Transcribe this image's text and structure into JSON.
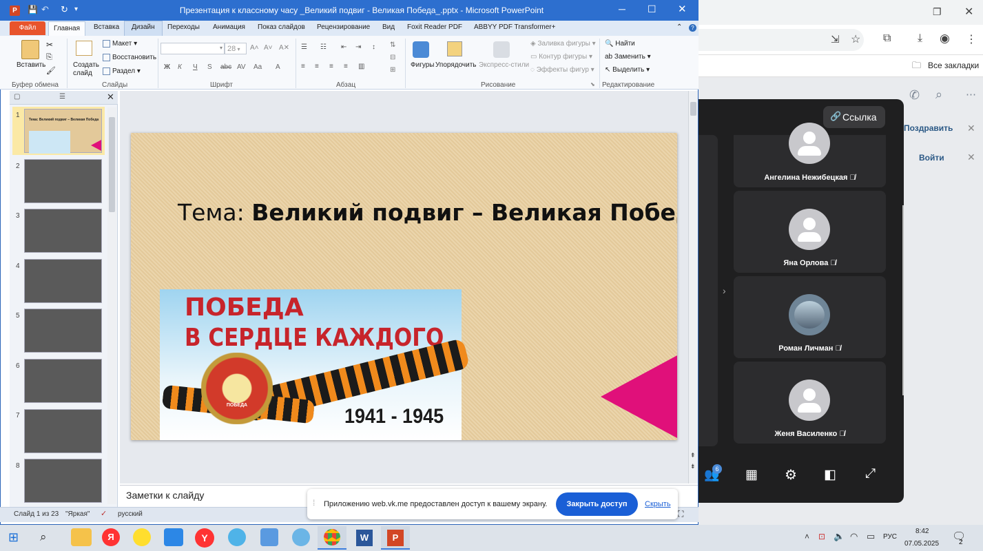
{
  "window": {
    "title": "Презентация к классному часу _Великий подвиг - Великая Победа_.pptx  -  Microsoft PowerPoint"
  },
  "ribbon": {
    "tabs": [
      "Файл",
      "Главная",
      "Вставка",
      "Дизайн",
      "Переходы",
      "Анимация",
      "Показ слайдов",
      "Рецензирование",
      "Вид",
      "Foxit Reader PDF",
      "ABBYY PDF Transformer+"
    ],
    "clipboard": {
      "paste": "Вставить",
      "label": "Буфер обмена"
    },
    "slides": {
      "create": "Создать слайд",
      "layout": "Макет",
      "restore": "Восстановить",
      "section": "Раздел",
      "label": "Слайды"
    },
    "font": {
      "size": "28",
      "label": "Шрифт"
    },
    "paragraph": {
      "label": "Абзац"
    },
    "drawing": {
      "shapes": "Фигуры",
      "arrange": "Упорядочить",
      "quick_styles": "Экспресс-стили",
      "fill": "Заливка фигуры",
      "outline": "Контур фигуры",
      "effects": "Эффекты фигур",
      "label": "Рисование"
    },
    "editing": {
      "find": "Найти",
      "replace": "Заменить",
      "select": "Выделить",
      "label": "Редактирование"
    }
  },
  "slide": {
    "title_prefix": "Тема: ",
    "title_bold": "Великий подвиг – Великая Победа",
    "poster_line1": "ПОБЕДА",
    "poster_line2": "В СЕРДЦЕ КАЖДОГО",
    "poster_years": "1941 - 1945",
    "poster_medal": "ПОБЕДА"
  },
  "thumbnails": {
    "numbers": [
      "1",
      "2",
      "3",
      "4",
      "5",
      "6",
      "7",
      "8"
    ],
    "thumb1_title": "Тема: Великий подвиг – Великая Победа"
  },
  "notes": {
    "placeholder": "Заметки к слайду"
  },
  "status": {
    "slide": "Слайд 1 из 23",
    "theme": "\"Яркая\"",
    "language": "русский"
  },
  "share_banner": {
    "text": "Приложению web.vk.me предоставлен доступ к вашему экрану.",
    "stop_button": "Закрыть доступ",
    "hide_link": "Скрыть"
  },
  "browser": {
    "bookmarks": "Все закладки",
    "vk": {
      "link_button": "Ссылка",
      "congratulate": "Поздравить",
      "login": "Войти",
      "participants_badge": "6",
      "participants": [
        {
          "name": "Ангелина Нежибецкая"
        },
        {
          "name": "Яна Орлова"
        },
        {
          "name": "Роман Личман"
        },
        {
          "name": "Женя Василенко"
        }
      ]
    }
  },
  "taskbar": {
    "time": "8:42",
    "date": "07.05.2025",
    "lang": "РУС",
    "notifications": "2"
  }
}
